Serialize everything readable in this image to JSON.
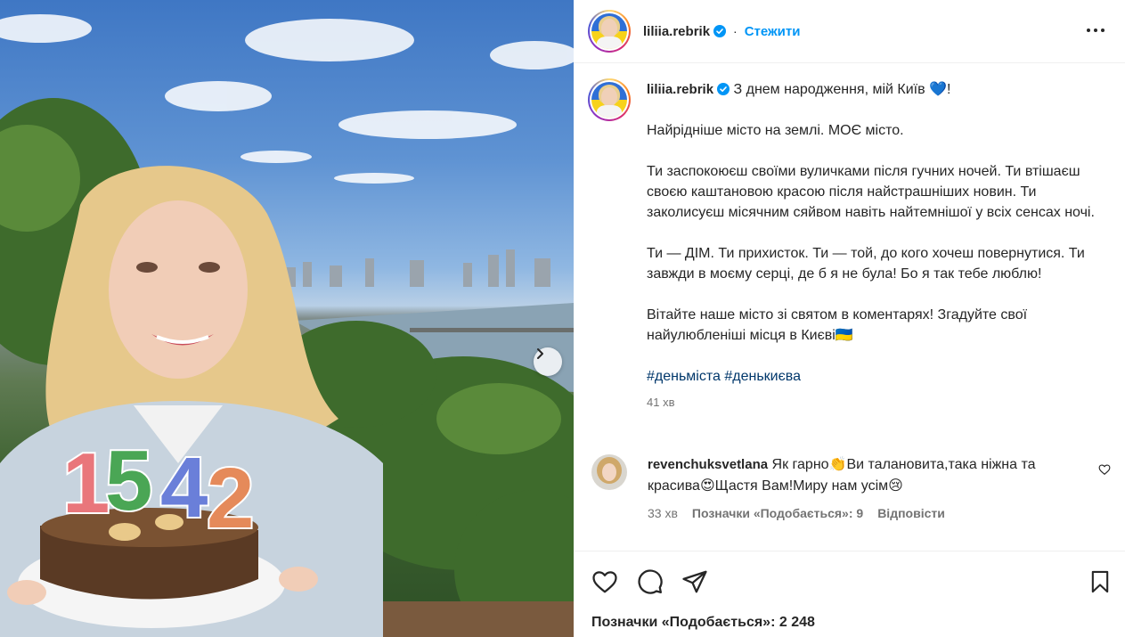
{
  "post": {
    "username": "liliia.rebrik",
    "follow_label": "Стежити",
    "header_dot": "·"
  },
  "caption": {
    "username": "liliia.rebrik",
    "line1": "З днем народження, мій Київ",
    "line1_emoji": "💙",
    "line1_end": "!",
    "para1": "Найрідніше місто на землі. МОЄ місто.",
    "para2": "Ти заспокоюєш своїми вуличками після гучних ночей. Ти втішаєш своєю каштановою красою після найстрашніших новин. Ти заколисуєш місячним сяйвом навіть найтемнішої у всіх сенсах ночі.",
    "para3": "Ти — ДІМ. Ти прихисток. Ти — той, до кого хочеш повернутися. Ти завжди в моєму серці, де б я не була! Бо я так тебе люблю!",
    "para4": "Вітайте наше місто зі святом в коментарях! Згадуйте свої найулюбленіші місця в Києві🇺🇦",
    "hashtag1": "#деньміста",
    "hashtag2": "#денькиєва",
    "time": "41 хв"
  },
  "comment": {
    "username": "revenchuksvetlana",
    "text": "Як гарно👏Ви талановита,така ніжна та красива😍Щастя Вам!Миру нам усім😢",
    "time": "33 хв",
    "likes": "Позначки «Подобається»: 9",
    "reply": "Відповісти"
  },
  "footer": {
    "likes": "Позначки «Подобається»: 2 248"
  },
  "photo": {
    "candle_number": "1542"
  },
  "colors": {
    "link": "#0095f6",
    "hashtag": "#00376b",
    "verified": "#0095f6",
    "muted": "#737373"
  }
}
